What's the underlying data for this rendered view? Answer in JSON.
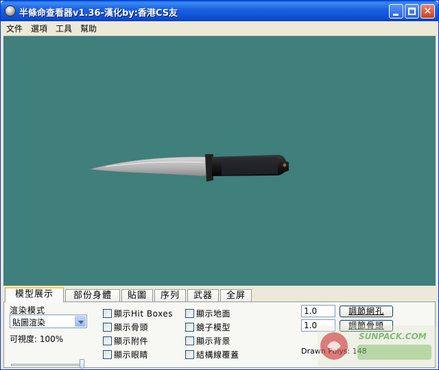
{
  "window": {
    "title": "半條命查看器v1.36-漢化by:香港CS友"
  },
  "menu": [
    "文件",
    "選項",
    "工具",
    "幫助"
  ],
  "tabs": [
    "模型展示",
    "部份身體",
    "貼圖",
    "序列",
    "武器",
    "全屏"
  ],
  "render": {
    "mode_label": "渲染模式",
    "mode_value": "貼圖渲染",
    "visibility_label": "可視度: 100%",
    "visibility_level": 1.0
  },
  "checkboxes_col1": [
    "顯示Hit Boxes",
    "顯示骨頭",
    "顯示附件",
    "顯示眼睛"
  ],
  "checkboxes_col2": [
    "顯示地面",
    "鏡子模型",
    "顯示背景",
    "結構線覆蓋"
  ],
  "controls": {
    "grid_value": "1.0",
    "grid_button": "調節網孔",
    "bone_value": "1.0",
    "bone_button": "調節骨頭",
    "drawn_polys": "Drawn Polys: 148"
  },
  "watermark_text": "SUNPACK.COM",
  "colors": {
    "viewport": "#3f7f7c",
    "titlebar": "#0d4fd3",
    "active_tab_accent": "#ffc83c"
  },
  "icons": [
    "app-icon",
    "minimize-icon",
    "maximize-icon",
    "close-icon",
    "dropdown-arrow-icon"
  ]
}
